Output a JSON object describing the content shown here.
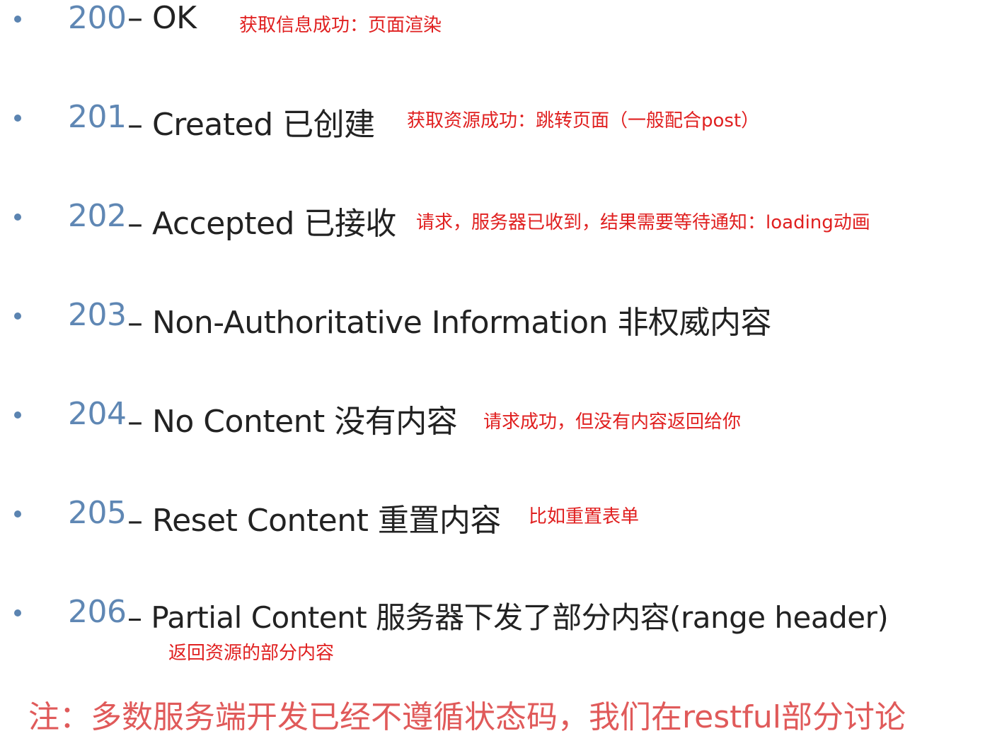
{
  "items": [
    {
      "code": "200",
      "title": "– OK",
      "note": "获取信息成功：页面渲染"
    },
    {
      "code": "201",
      "title": "– Created 已创建",
      "note": "获取资源成功：跳转页面（一般配合post）"
    },
    {
      "code": "202",
      "title": "– Accepted 已接收",
      "note": "请求，服务器已收到，结果需要等待通知：loading动画"
    },
    {
      "code": "203",
      "title": "– Non-Authoritative Information 非权威内容",
      "note": ""
    },
    {
      "code": "204",
      "title": "– No Content 没有内容",
      "note": "请求成功，但没有内容返回给你"
    },
    {
      "code": "205",
      "title": "– Reset Content 重置内容",
      "note": "比如重置表单"
    },
    {
      "code": "206",
      "title": "– Partial Content 服务器下发了部分内容(range header)",
      "note": "返回资源的部分内容"
    }
  ],
  "footer_note": "注：多数服务端开发已经不遵循状态码，我们在restful部分讨论",
  "colors": {
    "bullet": "#5b84b1",
    "code": "#5f87b4",
    "title": "#222222",
    "note": "#e02020",
    "footer": "#e05a5a"
  }
}
